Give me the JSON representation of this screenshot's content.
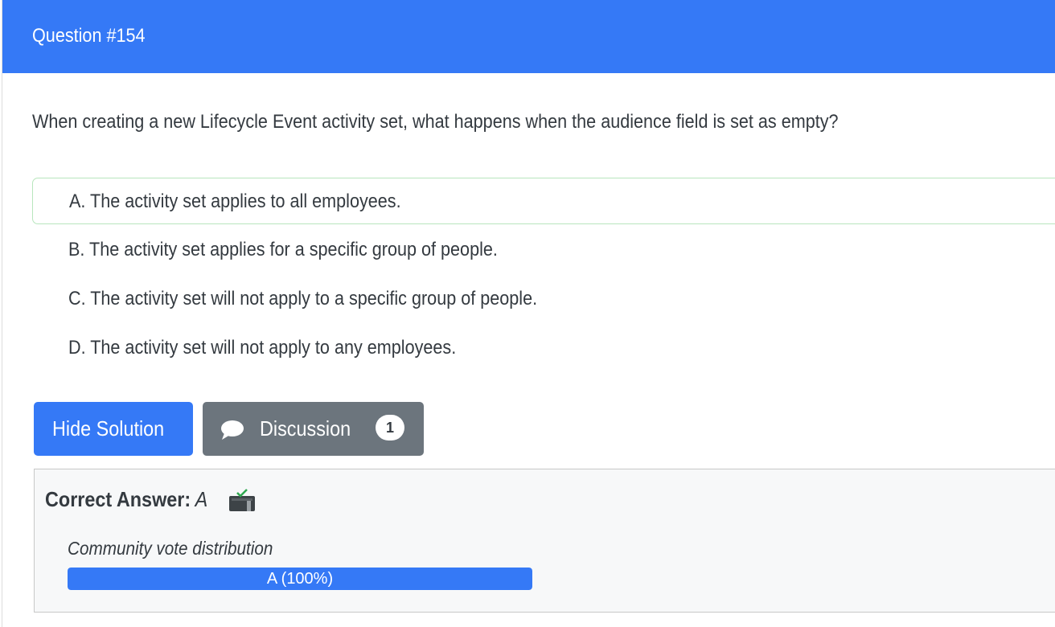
{
  "question": {
    "header": "Question #154",
    "text": "When creating a new Lifecycle Event activity set, what happens when the audience field is set as empty?"
  },
  "choices": [
    {
      "label": "A. The activity set applies to all employees.",
      "selected": true
    },
    {
      "label": "B. The activity set applies for a specific group of people.",
      "selected": false
    },
    {
      "label": "C. The activity set will not apply to a specific group of people.",
      "selected": false
    },
    {
      "label": "D. The activity set will not apply to any employees.",
      "selected": false
    }
  ],
  "buttons": {
    "solution_label": "Hide Solution",
    "discussion_label": "Discussion",
    "discussion_count": "1"
  },
  "answer": {
    "label": "Correct Answer:",
    "value": "A",
    "icon": "ballot-box-icon"
  },
  "votes": {
    "title": "Community vote distribution",
    "items": [
      {
        "label": "A (100%)",
        "fraction": 1.0
      }
    ]
  },
  "colors": {
    "primary": "#3579f6",
    "secondary": "#6c757d",
    "selected_border": "#b8e6bd",
    "answer_background": "#f7f8f9"
  }
}
